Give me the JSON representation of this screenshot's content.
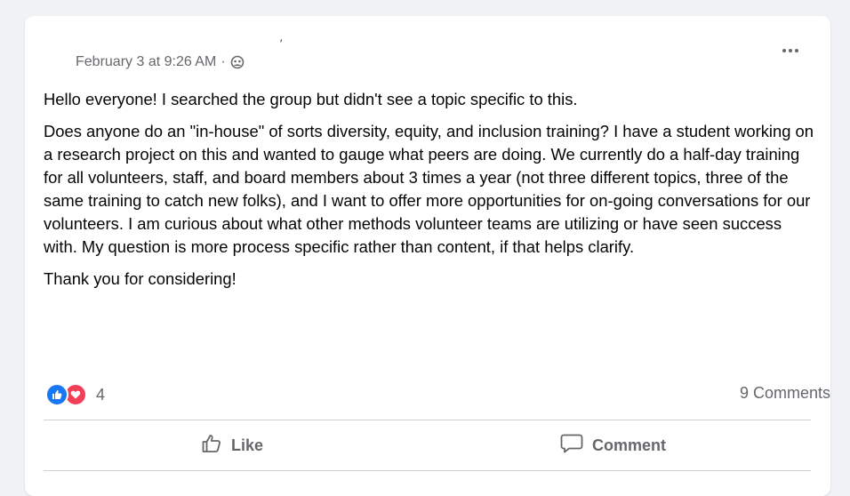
{
  "post": {
    "timestamp": "February 3 at 9:26 AM",
    "separator": "·",
    "audience_icon": "group-icon",
    "paragraphs": [
      "Hello everyone! I searched the group but didn't see a topic specific to this.",
      "Does anyone do an \"in-house\" of sorts diversity, equity, and inclusion training? I have a student working on a research project on this and wanted to gauge what peers are doing. We currently do a half-day training for all volunteers, staff, and board members about 3 times a year (not three different topics, three of the same training to catch new folks), and I want to offer more opportunities for on-going conversations for our volunteers. I am curious about what other methods volunteer teams are utilizing or have seen success with. My question is more process specific rather than content, if that helps clarify.",
      "Thank you for considering!"
    ]
  },
  "reactions": {
    "count": "4",
    "types": [
      "like-icon",
      "love-icon"
    ]
  },
  "comments_label": "9 Comments",
  "actions": {
    "like_label": "Like",
    "comment_label": "Comment"
  },
  "colors": {
    "background": "#f0f2f5",
    "card": "#ffffff",
    "secondary_text": "#65676b",
    "primary_text": "#050505",
    "like_blue": "#1877f2",
    "love_red": "#f33e58",
    "divider": "#ced0d4"
  }
}
